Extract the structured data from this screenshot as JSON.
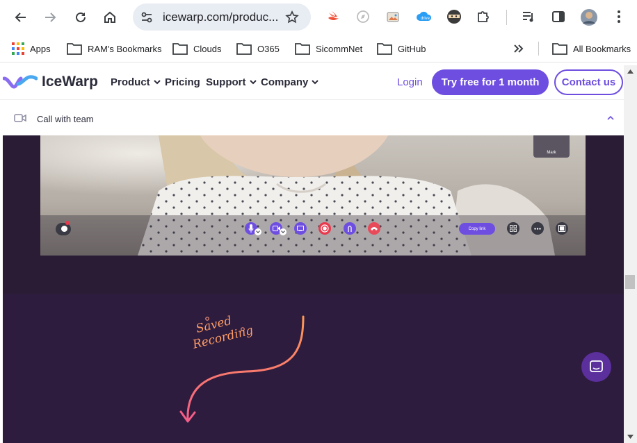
{
  "browser": {
    "url": "icewarp.com/produc...",
    "bookmarks": [
      {
        "label": "Apps"
      },
      {
        "label": "RAM's Bookmarks"
      },
      {
        "label": "Clouds"
      },
      {
        "label": "O365"
      },
      {
        "label": "SicommNet"
      },
      {
        "label": "GitHub"
      }
    ],
    "all_bookmarks": "All Bookmarks"
  },
  "site": {
    "brand": "IceWarp",
    "nav": [
      "Product",
      "Pricing",
      "Support",
      "Company"
    ],
    "login": "Login",
    "try_free": "Try free for 1 month",
    "contact": "Contact us"
  },
  "call": {
    "title": "Call with team",
    "participant": "Mark",
    "copy_link": "Copy link"
  },
  "annotation": {
    "line1": "Saved",
    "line2": "Recording"
  },
  "colors": {
    "accent": "#6e4ee0",
    "dark_bg": "#2d1c3d",
    "end_call": "#e94a5a",
    "record": "#e83a4e",
    "arrow_start": "#ff9a52",
    "arrow_end": "#f45d87"
  }
}
